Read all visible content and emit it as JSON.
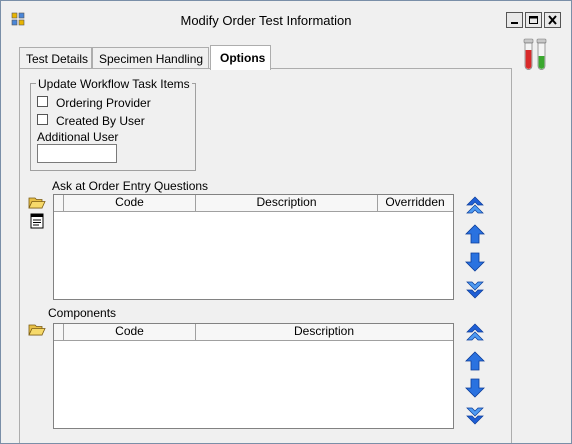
{
  "window": {
    "title": "Modify Order Test Information",
    "icons": {
      "app": "app-grid-icon",
      "minimize": "minimize-icon",
      "maximize": "maximize-icon",
      "close": "close-icon"
    }
  },
  "tabs": [
    {
      "label": "Test Details",
      "active": false
    },
    {
      "label": "Specimen Handling",
      "active": false
    },
    {
      "label": "Options",
      "active": true
    }
  ],
  "decor": {
    "icon": "test-tubes-icon"
  },
  "workflow": {
    "legend": "Update Workflow Task Items",
    "ordering_provider_label": "Ordering Provider",
    "ordering_provider_checked": false,
    "created_by_user_label": "Created By User",
    "created_by_user_checked": false,
    "additional_user_label": "Additional User",
    "additional_user_value": ""
  },
  "questions": {
    "label": "Ask at Order Entry Questions",
    "columns": [
      "Code",
      "Description",
      "Overridden"
    ],
    "rows": [],
    "icons": [
      "open-folder-icon",
      "notes-icon"
    ]
  },
  "components": {
    "label": "Components",
    "columns": [
      "Code",
      "Description"
    ],
    "rows": [],
    "icons": [
      "open-folder-icon"
    ]
  },
  "move_buttons": [
    "move-to-top-icon",
    "move-up-icon",
    "move-down-icon",
    "move-to-bottom-icon"
  ],
  "colors": {
    "arrow_blue": "#1f5fd6",
    "arrow_blue_light": "#4f9bf2",
    "tube_red": "#d92a2a",
    "tube_green": "#3aa82e"
  }
}
